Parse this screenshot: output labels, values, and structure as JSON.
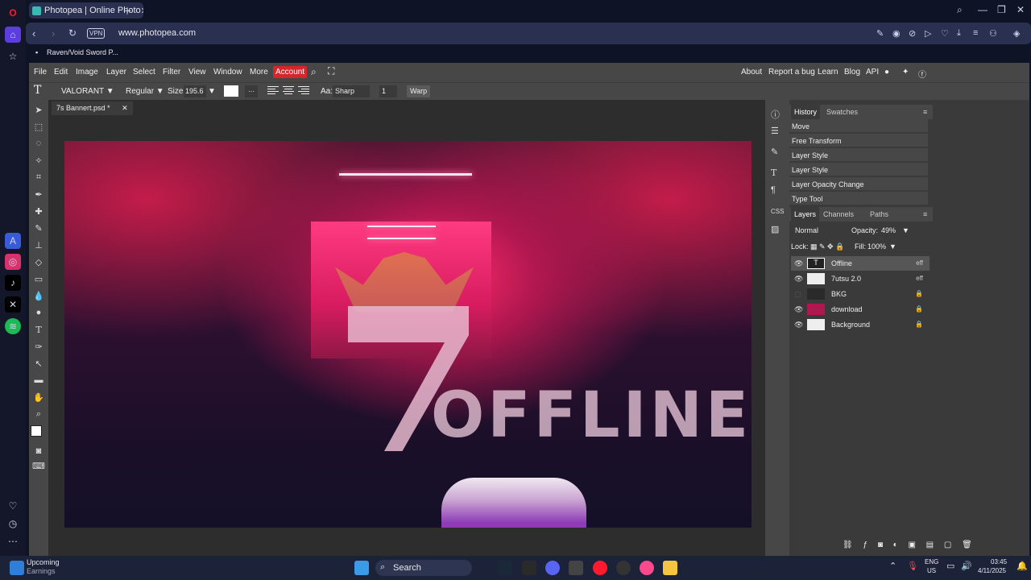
{
  "browser": {
    "tab_title": "Photopea | Online Photo",
    "url": "www.photopea.com",
    "vpn": "VPN",
    "bookmark": "Raven/Void Sword P..."
  },
  "photopea": {
    "menus": [
      "File",
      "Edit",
      "Image",
      "Layer",
      "Select",
      "Filter",
      "View",
      "Window",
      "More",
      "Account"
    ],
    "right_links": [
      "About",
      "Report a bug",
      "Learn",
      "Blog",
      "API"
    ],
    "options": {
      "font": "VALORANT ▼",
      "style": "Regular ▼",
      "size_label": "Size:",
      "size_value": "195.6",
      "dots": "...",
      "aa_label": "Aa:",
      "aa_value": "Sharp",
      "num": "1",
      "warp": "Warp"
    },
    "doc_tab": "7s Bannert.psd *",
    "canvas_text": "OFFLINE",
    "history_tabs": [
      "History",
      "Swatches"
    ],
    "history": [
      "Move",
      "Free Transform",
      "Layer Style",
      "Layer Style",
      "Layer Opacity Change",
      "Type Tool"
    ],
    "layer_tabs": [
      "Layers",
      "Channels",
      "Paths"
    ],
    "blend_mode": "Normal",
    "opacity_label": "Opacity:",
    "opacity_value": "49%",
    "lock_label": "Lock:",
    "fill_label": "Fill:",
    "fill_value": "100%",
    "layers": [
      {
        "name": "Offline",
        "visible": true,
        "right": "eff"
      },
      {
        "name": "7utsu 2.0",
        "visible": true,
        "right": "eff"
      },
      {
        "name": "BKG",
        "visible": false,
        "right": "🔒"
      },
      {
        "name": "download",
        "visible": true,
        "right": "🔒"
      },
      {
        "name": "Background",
        "visible": true,
        "right": "🔒"
      }
    ]
  },
  "taskbar": {
    "weather_title": "Upcoming",
    "weather_sub": "Earnings",
    "search": "Search",
    "lang1": "ENG",
    "lang2": "US",
    "time": "03:45",
    "date": "4/11/2025"
  }
}
